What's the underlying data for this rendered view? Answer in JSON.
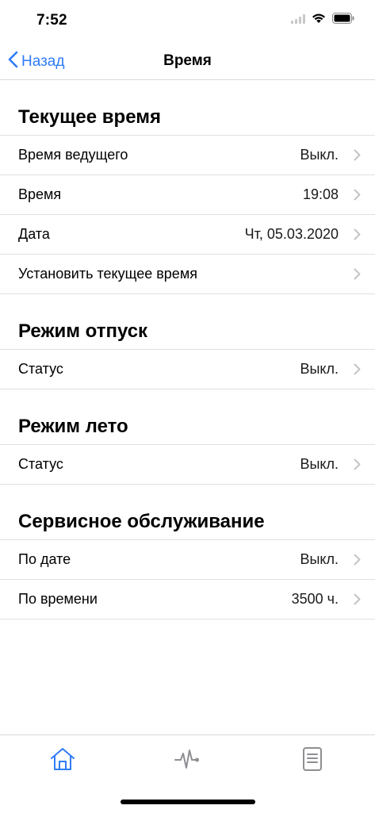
{
  "status_bar": {
    "time": "7:52",
    "icons": [
      "signal-icon",
      "wifi-icon",
      "battery-icon"
    ]
  },
  "nav": {
    "back_label": "Назад",
    "title": "Время"
  },
  "accent_color": "#2f7cf6",
  "sections": [
    {
      "title": "Текущее время",
      "rows": [
        {
          "label": "Время ведущего",
          "value": "Выкл."
        },
        {
          "label": "Время",
          "value": "19:08"
        },
        {
          "label": "Дата",
          "value": "Чт, 05.03.2020"
        },
        {
          "label": "Установить текущее время",
          "value": ""
        }
      ]
    },
    {
      "title": "Режим отпуск",
      "rows": [
        {
          "label": "Статус",
          "value": "Выкл."
        }
      ]
    },
    {
      "title": "Режим лето",
      "rows": [
        {
          "label": "Статус",
          "value": "Выкл."
        }
      ]
    },
    {
      "title": "Сервисное обслуживание",
      "rows": [
        {
          "label": "По дате",
          "value": "Выкл."
        },
        {
          "label": "По времени",
          "value": "3500 ч."
        }
      ]
    }
  ],
  "tabs": [
    {
      "icon": "home-icon",
      "active": true
    },
    {
      "icon": "activity-pulse-icon",
      "active": false
    },
    {
      "icon": "document-icon",
      "active": false
    }
  ]
}
